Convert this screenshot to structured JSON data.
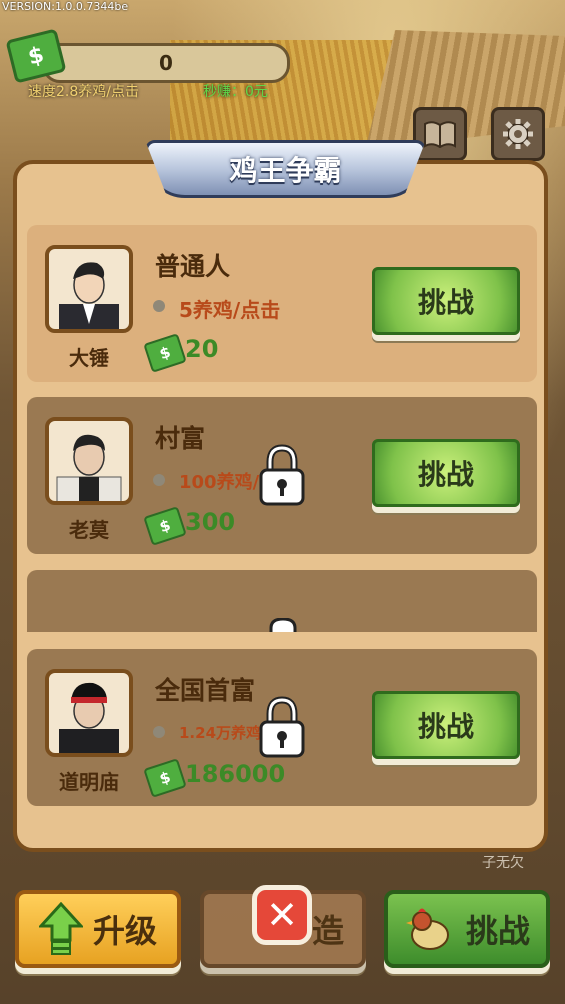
{
  "version": "VERSION:1.0.0.7344be",
  "hud": {
    "money_icon": "$",
    "coins": "0",
    "speed": "速度2.8养鸡/点击",
    "income": "秒赚：0元"
  },
  "dialog": {
    "title": "鸡王争霸",
    "cards": [
      {
        "name": "大锤",
        "title": "普通人",
        "rate": "5养鸡/点击",
        "cost": "20",
        "button": "挑战",
        "locked": false
      },
      {
        "name": "老莫",
        "title": "村富",
        "rate": "100养鸡/",
        "cost": "300",
        "button": "挑战",
        "locked": true
      },
      {
        "name": "道明庙",
        "title": "全国首富",
        "rate": "1.24万养鸡/",
        "cost": "186000",
        "button": "挑战",
        "locked": true
      }
    ]
  },
  "bottom_bar": {
    "upgrade": "升级",
    "build": "造",
    "challenge": "挑战",
    "close": "✕"
  },
  "watermark": "子无欠",
  "colors": {
    "panel": "#e7c28f",
    "button_green": "#7fc24a",
    "cost_green": "#3c8a27",
    "rate_red": "#b84a1a"
  },
  "icons": [
    "money-icon",
    "book-icon",
    "gear-icon",
    "lock-icon",
    "close-icon",
    "up-arrow-icon",
    "chicken-icon"
  ]
}
